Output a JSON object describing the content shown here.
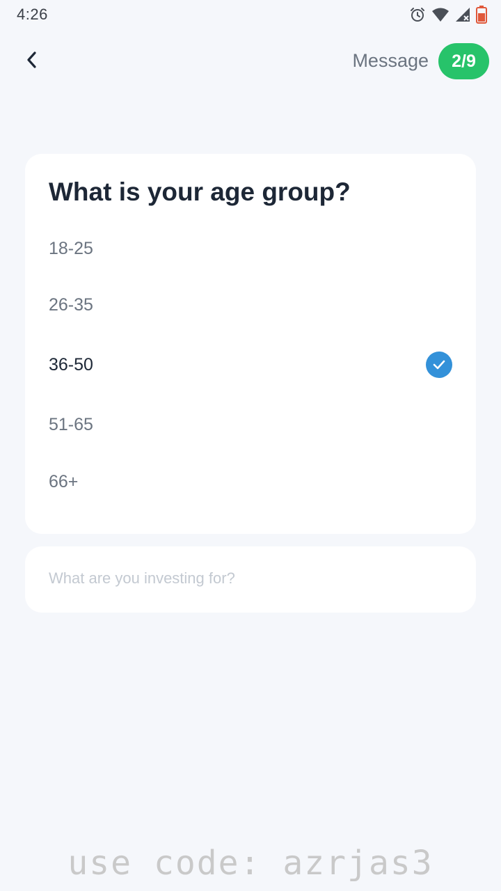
{
  "status_bar": {
    "time": "4:26",
    "icons": [
      "alarm-icon",
      "wifi-icon",
      "signal-icon",
      "battery-icon"
    ]
  },
  "header": {
    "back_icon": "chevron-left-icon",
    "message_label": "Message",
    "progress": "2/9",
    "progress_color": "#27c36a"
  },
  "question": {
    "title": "What is your age group?",
    "options": [
      {
        "label": "18-25",
        "selected": false
      },
      {
        "label": "26-35",
        "selected": false
      },
      {
        "label": "36-50",
        "selected": true
      },
      {
        "label": "51-65",
        "selected": false
      },
      {
        "label": "66+",
        "selected": false
      }
    ],
    "selected_color": "#3391d9"
  },
  "next_question": {
    "title": "What are you investing for?"
  },
  "watermark": {
    "text": "use code: azrjas3"
  }
}
